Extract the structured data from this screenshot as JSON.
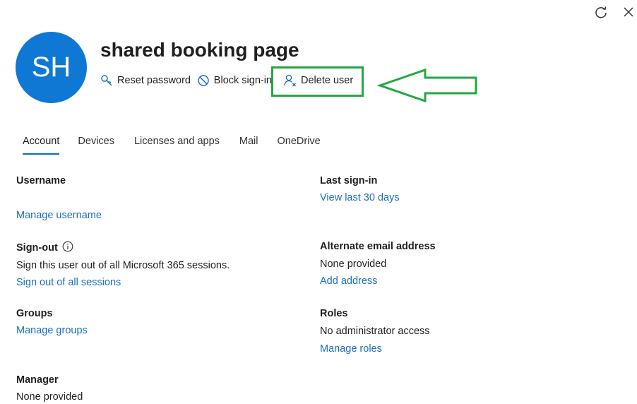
{
  "header": {
    "avatar_initials": "SH",
    "title": "shared booking page"
  },
  "commands": {
    "reset_password": "Reset password",
    "block_sign_in": "Block sign-in",
    "delete_user": "Delete user"
  },
  "tabs": [
    {
      "label": "Account",
      "active": true
    },
    {
      "label": "Devices",
      "active": false
    },
    {
      "label": "Licenses and apps",
      "active": false
    },
    {
      "label": "Mail",
      "active": false
    },
    {
      "label": "OneDrive",
      "active": false
    }
  ],
  "left": {
    "username": {
      "label": "Username",
      "link": "Manage username"
    },
    "signout": {
      "label": "Sign-out",
      "text": "Sign this user out of all Microsoft 365 sessions.",
      "link": "Sign out of all sessions"
    },
    "groups": {
      "label": "Groups",
      "link": "Manage groups"
    },
    "manager": {
      "label": "Manager",
      "text": "None provided"
    }
  },
  "right": {
    "last_signin": {
      "label": "Last sign-in",
      "link": "View last 30 days"
    },
    "alternate_email": {
      "label": "Alternate email address",
      "text": "None provided",
      "link": "Add address"
    },
    "roles": {
      "label": "Roles",
      "text": "No administrator access",
      "link": "Manage roles"
    }
  },
  "colors": {
    "avatar": "#0f78d4",
    "link": "#1b6ec2",
    "highlight": "#22a843",
    "tab_underline": "#0f6cbd"
  }
}
